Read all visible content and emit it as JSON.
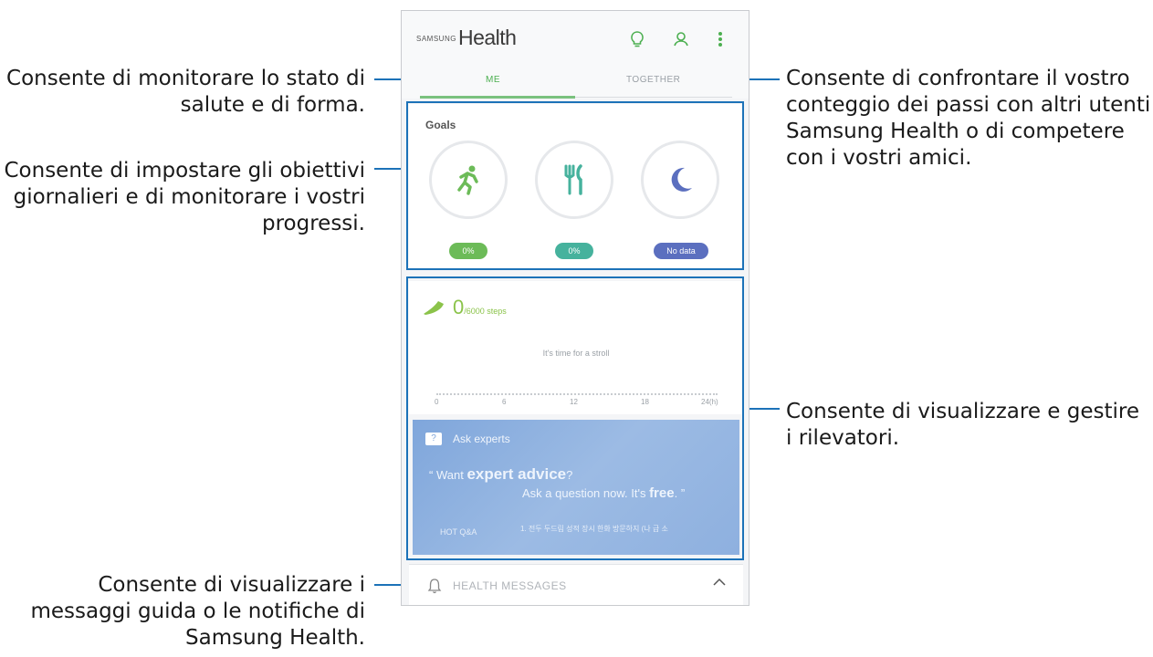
{
  "app": {
    "brand": "SAMSUNG",
    "title": "Health",
    "tabs": {
      "me": "ME",
      "together": "TOGETHER"
    },
    "icons": [
      "lightbulb-icon",
      "profile-icon",
      "more-options-icon"
    ],
    "accent": "#4caf50"
  },
  "goals": {
    "title": "Goals",
    "items": [
      {
        "icon": "running-icon",
        "badge": "0%",
        "color": "#6cbb58"
      },
      {
        "icon": "fork-knife-icon",
        "badge": "0%",
        "color": "#46b29d"
      },
      {
        "icon": "moon-icon",
        "badge": "No data",
        "color": "#5b6fbf"
      }
    ]
  },
  "steps": {
    "count": "0",
    "goal": "/6000 steps",
    "message": "It's time for a stroll",
    "ticks": [
      "0",
      "6",
      "12",
      "18",
      "24(h)"
    ]
  },
  "ask_experts": {
    "title": "Ask experts",
    "line1_prefix": "Want ",
    "line1_bold": "expert advice",
    "line1_suffix": "?",
    "line2_prefix": "Ask a question now. It's ",
    "line2_bold": "free",
    "line2_suffix": ".",
    "hot_label": "HOT Q&A",
    "hot_text": "1. 전두 두드림 성적 장시 한화 방문하지 (나 급 소"
  },
  "messages_bar": {
    "label": "HEALTH MESSAGES"
  },
  "callouts": {
    "me": "Consente di monitorare lo stato di salute e di forma.",
    "goals": "Consente di impostare gli obiettivi giornalieri e di monitorare i vostri progressi.",
    "messages": "Consente di visualizzare i messaggi guida o le notifiche di Samsung Health.",
    "together": "Consente di confrontare il vostro conteggio dei passi con altri utenti Samsung Health o di competere con i vostri amici.",
    "trackers": "Consente di visualizzare e gestire i rilevatori."
  },
  "colors": {
    "callout_line": "#1c72b8"
  }
}
